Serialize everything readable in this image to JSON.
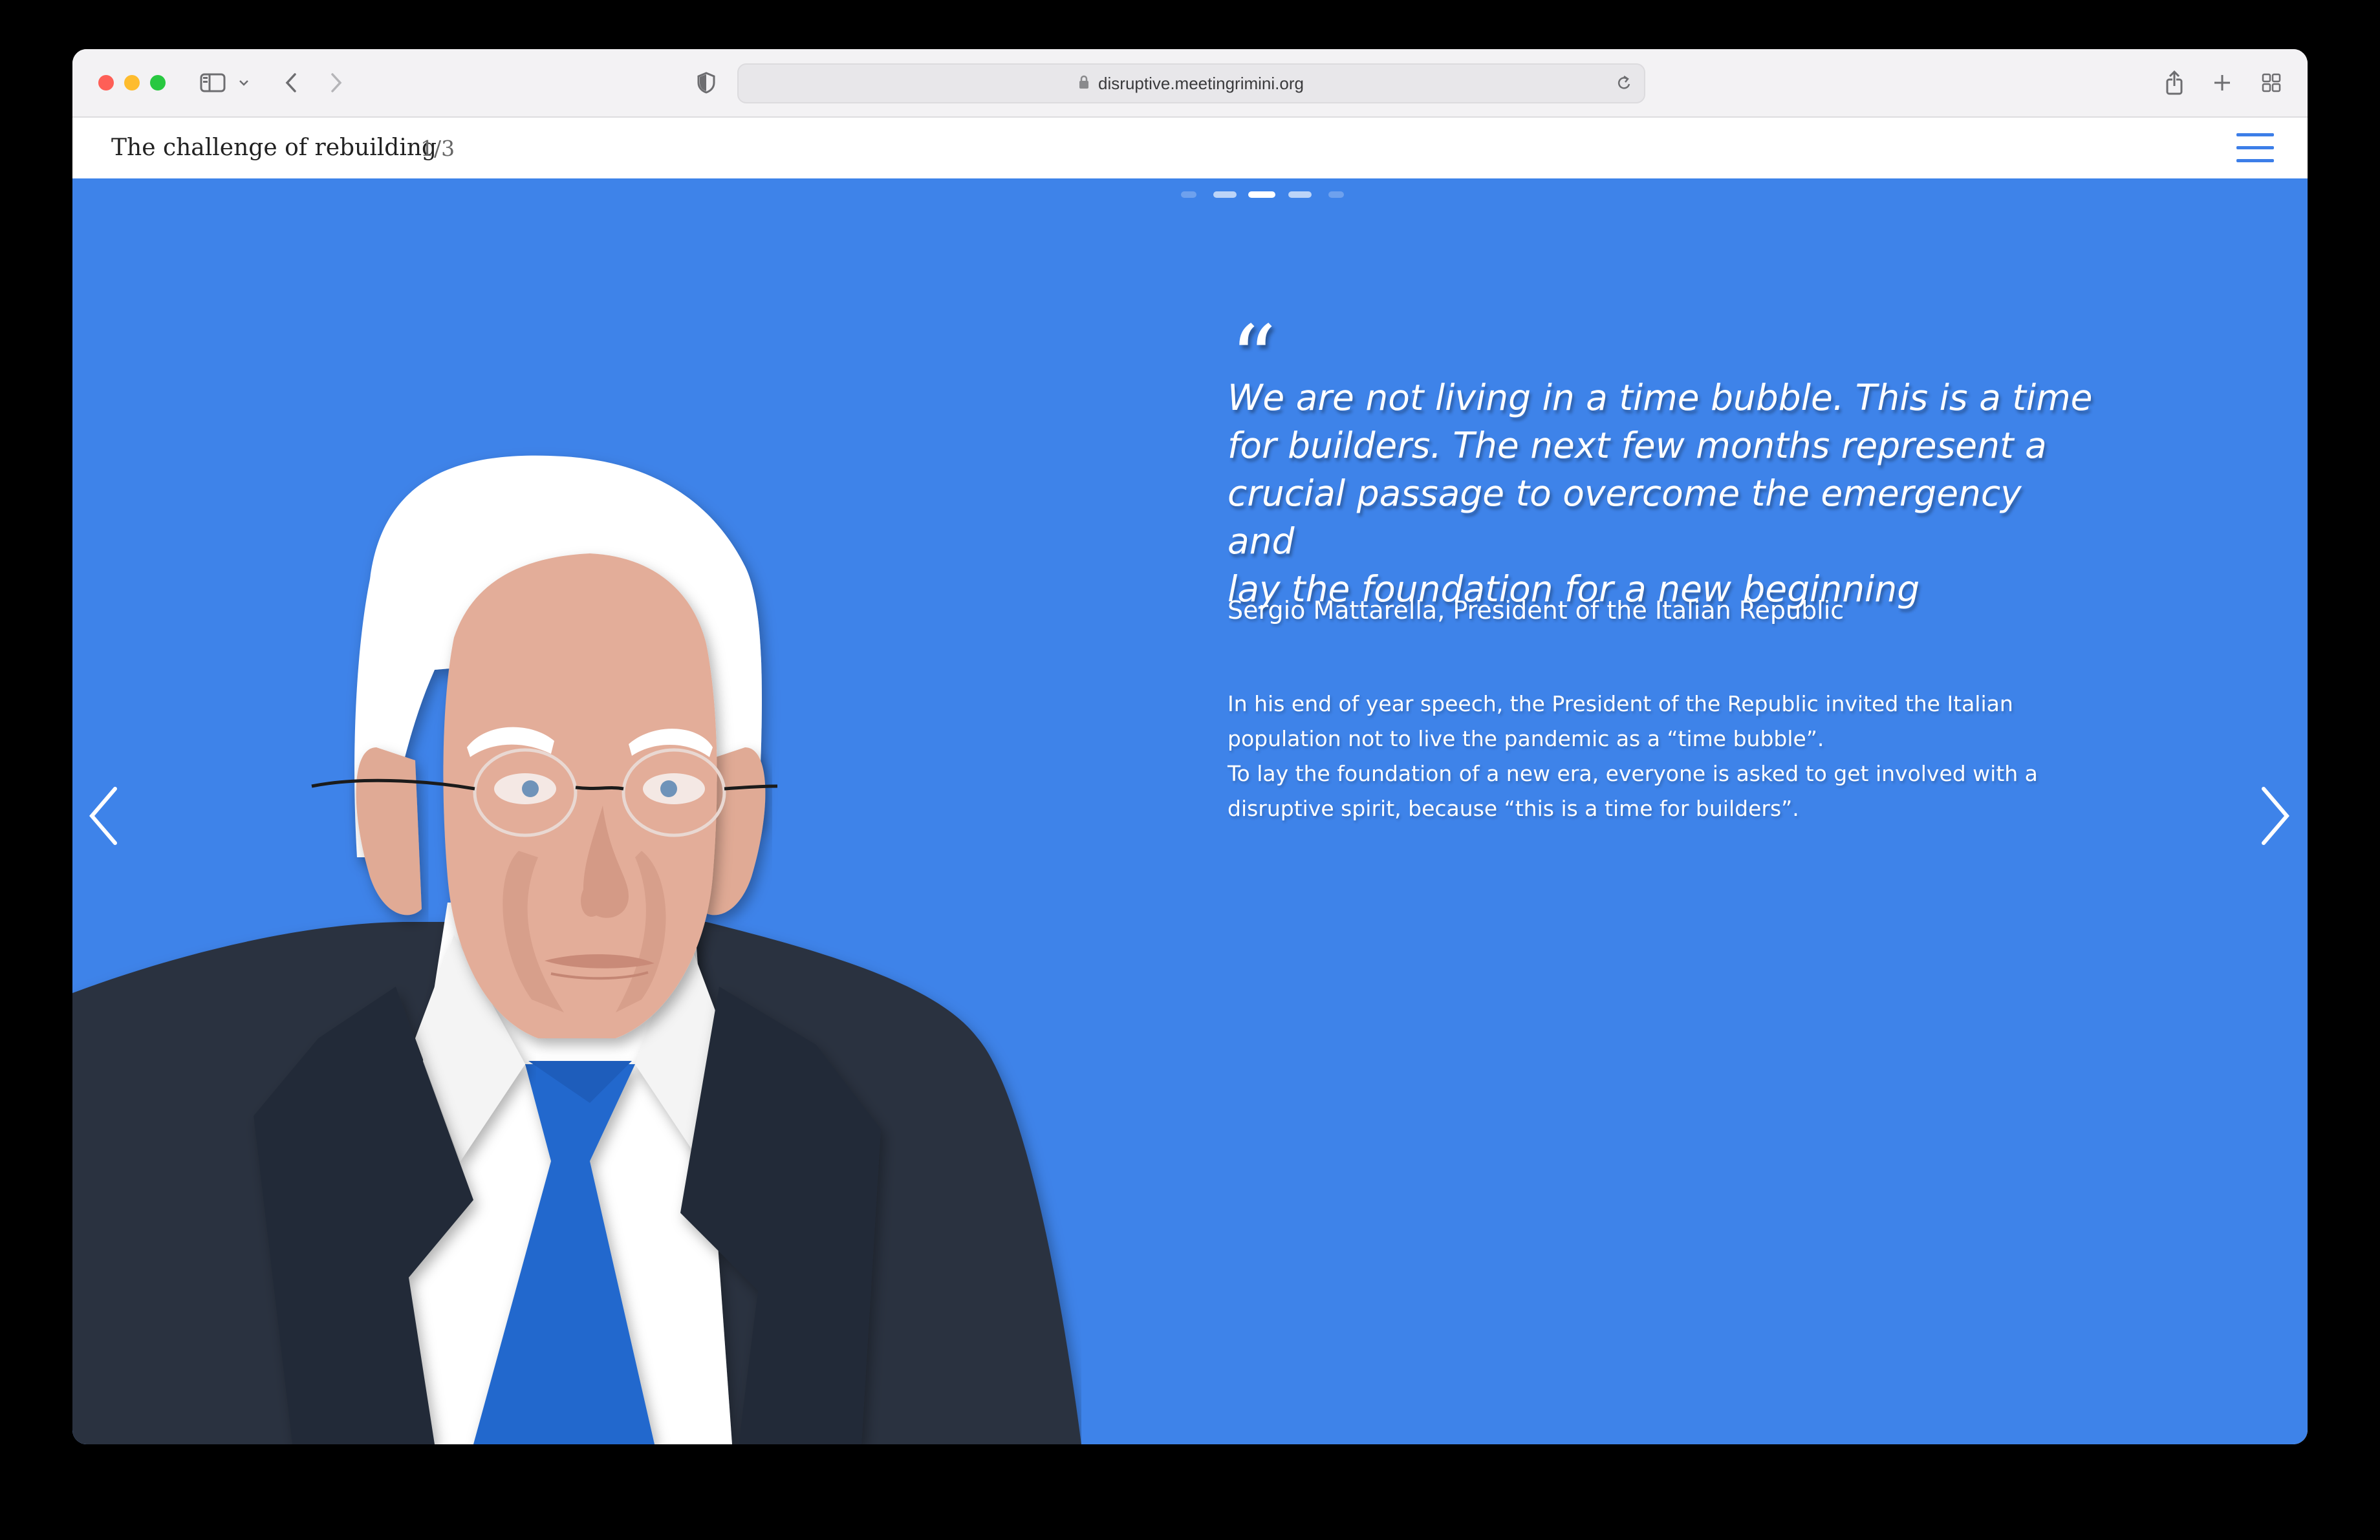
{
  "browser": {
    "url": "disruptive.meetingrimini.org",
    "icons": [
      "sidebar-icon",
      "chevron-down-icon",
      "back-icon",
      "forward-icon",
      "privacy-shield-icon",
      "lock-icon",
      "reload-icon",
      "share-icon",
      "new-tab-icon",
      "tab-overview-icon"
    ]
  },
  "header": {
    "title": "The challenge of rebuilding",
    "counter": "1/3",
    "menu_icon": "hamburger-menu-icon"
  },
  "slide": {
    "background": "#3e83e9",
    "pagination_dots": 5,
    "active_dot": 3,
    "quote_mark": "“",
    "quote_lines": [
      "We are not living in a time bubble. This is a time",
      "for builders. The next few months represent a",
      "crucial passage to overcome the emergency and",
      "lay the foundation for a new beginning"
    ],
    "author": "Sergio Mattarella, President of the Italian Republic",
    "description_lines": [
      "In his end of year speech, the President of the Republic invited the Italian",
      "population not to live the pandemic as a “time bubble”.",
      "To lay the foundation of a new era, everyone is asked to get involved with a",
      "disruptive spirit, because “this is a time for builders”."
    ],
    "prev_icon": "chevron-left-icon",
    "next_icon": "chevron-right-icon"
  }
}
